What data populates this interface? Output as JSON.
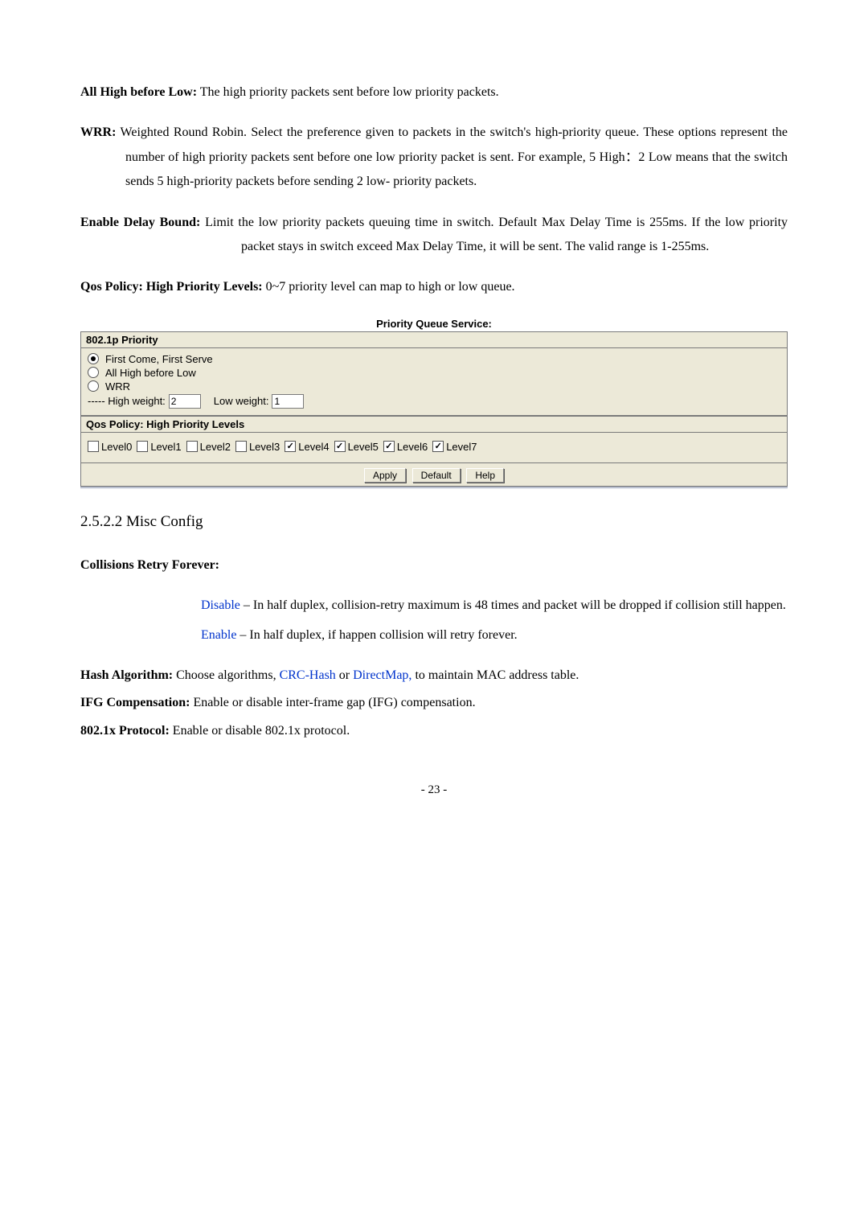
{
  "p1": {
    "label": "All High before Low:",
    "text": " The high priority packets sent before low priority packets."
  },
  "p2": {
    "label": "WRR:",
    "text": " Weighted Round Robin. Select the preference given to packets in the switch's high-priority queue. These options represent the number of high priority packets sent before one low priority packet is sent. For example, 5 High：2 Low means that the switch sends 5 high-priority packets before sending 2 low- priority packets."
  },
  "p3": {
    "label": "Enable Delay Bound:",
    "text": " Limit the low priority packets queuing time in switch. Default Max Delay Time is 255ms. If the low priority packet stays in switch exceed Max Delay Time, it will be sent. The valid range is 1-255ms."
  },
  "p4": {
    "label": "Qos Policy: High Priority Levels:",
    "text": " 0~7 priority level can map to high or low queue."
  },
  "ui": {
    "title": "Priority Queue Service:",
    "section1": "802.1p Priority",
    "opt_fcfs": "First Come, First Serve",
    "opt_ahbl": "All High before Low",
    "opt_wrr": "WRR",
    "weights_prefix": "----- High weight:",
    "high_val": "2",
    "low_label": "Low weight:",
    "low_val": "1",
    "section2": "Qos Policy: High Priority Levels",
    "levels": [
      "Level0",
      "Level1",
      "Level2",
      "Level3",
      "Level4",
      "Level5",
      "Level6",
      "Level7"
    ],
    "checked": [
      false,
      false,
      false,
      false,
      true,
      true,
      true,
      true
    ],
    "btn_apply": "Apply",
    "btn_default": "Default",
    "btn_help": "Help"
  },
  "h2": "2.5.2.2 Misc Config",
  "crf": {
    "label": "Collisions Retry Forever:"
  },
  "disable": {
    "k": "Disable",
    "t": " – In half duplex, collision-retry maximum is 48 times and packet will be dropped if collision still happen."
  },
  "enable": {
    "k": "Enable",
    "t": " – In half duplex, if happen collision will retry forever."
  },
  "hash": {
    "label": "Hash Algorithm:",
    "pre": " Choose algorithms, ",
    "a": "CRC-Hash",
    "mid": " or ",
    "b": "DirectMap,",
    "post": " to maintain MAC address table."
  },
  "ifg": {
    "label": "IFG Compensation:",
    "text": " Enable or disable inter-frame gap (IFG) compensation."
  },
  "dot1x": {
    "label": "802.1x Protocol:",
    "text": " Enable or disable 802.1x protocol."
  },
  "page": "- 23 -"
}
